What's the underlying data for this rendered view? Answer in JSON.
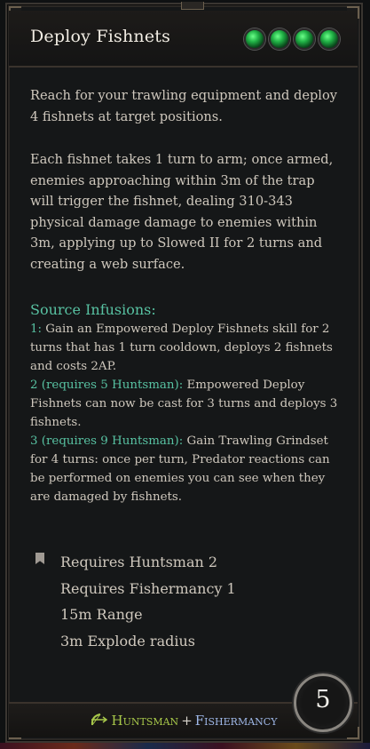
{
  "tooltip": {
    "title": "Deploy Fishnets",
    "action_points": 4,
    "description": [
      "Reach for your trawling equipment and deploy 4 fishnets at target positions.",
      "Each fishnet takes 1 turn to arm; once armed, enemies approaching within 3m of the trap will trigger the fishnet, dealing 310-343 physical damage damage to enemies within 3m, applying up to Slowed II for 2 turns and creating a web surface."
    ],
    "infusions_title": "Source Infusions:",
    "infusions": [
      {
        "label": "1:",
        "text": " Gain an Empowered Deploy Fishnets skill for 2 turns that has 1 turn cooldown, deploys 2 fishnets and costs 2AP."
      },
      {
        "label": "2 (requires 5 Huntsman):",
        "text": " Empowered Deploy Fishnets can now be cast for 3 turns and deploys 3 fishnets."
      },
      {
        "label": "3 (requires 9 Huntsman):",
        "text": " Gain Trawling Grindset for 4 turns: once per turn, Predator reactions can be performed on enemies you can see when they are damaged by fishnets."
      }
    ],
    "requirements": [
      "Requires Huntsman 2",
      "Requires Fishermancy 1",
      "15m  Range",
      "3m  Explode radius"
    ],
    "cost": "5",
    "school_primary": "Huntsman",
    "school_separator": "+",
    "school_secondary": "Fishermancy",
    "colors": {
      "infusion": "#58c2a2",
      "huntsman": "#a8c84a",
      "fishermancy": "#9fb8e8",
      "ap_orb": "#20b045"
    }
  }
}
